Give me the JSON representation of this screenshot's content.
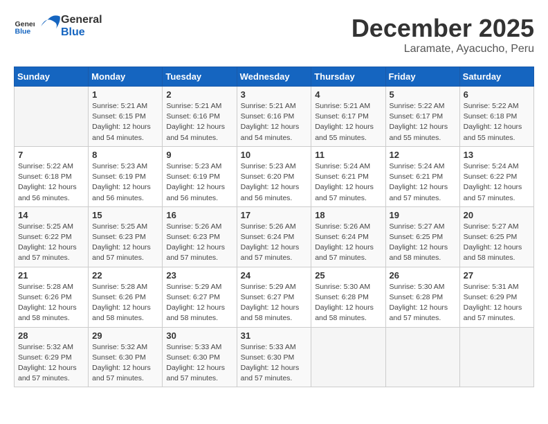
{
  "header": {
    "logo_general": "General",
    "logo_blue": "Blue",
    "month": "December 2025",
    "location": "Laramate, Ayacucho, Peru"
  },
  "calendar": {
    "days_of_week": [
      "Sunday",
      "Monday",
      "Tuesday",
      "Wednesday",
      "Thursday",
      "Friday",
      "Saturday"
    ],
    "weeks": [
      [
        {
          "day": "",
          "info": ""
        },
        {
          "day": "1",
          "info": "Sunrise: 5:21 AM\nSunset: 6:15 PM\nDaylight: 12 hours\nand 54 minutes."
        },
        {
          "day": "2",
          "info": "Sunrise: 5:21 AM\nSunset: 6:16 PM\nDaylight: 12 hours\nand 54 minutes."
        },
        {
          "day": "3",
          "info": "Sunrise: 5:21 AM\nSunset: 6:16 PM\nDaylight: 12 hours\nand 54 minutes."
        },
        {
          "day": "4",
          "info": "Sunrise: 5:21 AM\nSunset: 6:17 PM\nDaylight: 12 hours\nand 55 minutes."
        },
        {
          "day": "5",
          "info": "Sunrise: 5:22 AM\nSunset: 6:17 PM\nDaylight: 12 hours\nand 55 minutes."
        },
        {
          "day": "6",
          "info": "Sunrise: 5:22 AM\nSunset: 6:18 PM\nDaylight: 12 hours\nand 55 minutes."
        }
      ],
      [
        {
          "day": "7",
          "info": "Sunrise: 5:22 AM\nSunset: 6:18 PM\nDaylight: 12 hours\nand 56 minutes."
        },
        {
          "day": "8",
          "info": "Sunrise: 5:23 AM\nSunset: 6:19 PM\nDaylight: 12 hours\nand 56 minutes."
        },
        {
          "day": "9",
          "info": "Sunrise: 5:23 AM\nSunset: 6:19 PM\nDaylight: 12 hours\nand 56 minutes."
        },
        {
          "day": "10",
          "info": "Sunrise: 5:23 AM\nSunset: 6:20 PM\nDaylight: 12 hours\nand 56 minutes."
        },
        {
          "day": "11",
          "info": "Sunrise: 5:24 AM\nSunset: 6:21 PM\nDaylight: 12 hours\nand 57 minutes."
        },
        {
          "day": "12",
          "info": "Sunrise: 5:24 AM\nSunset: 6:21 PM\nDaylight: 12 hours\nand 57 minutes."
        },
        {
          "day": "13",
          "info": "Sunrise: 5:24 AM\nSunset: 6:22 PM\nDaylight: 12 hours\nand 57 minutes."
        }
      ],
      [
        {
          "day": "14",
          "info": "Sunrise: 5:25 AM\nSunset: 6:22 PM\nDaylight: 12 hours\nand 57 minutes."
        },
        {
          "day": "15",
          "info": "Sunrise: 5:25 AM\nSunset: 6:23 PM\nDaylight: 12 hours\nand 57 minutes."
        },
        {
          "day": "16",
          "info": "Sunrise: 5:26 AM\nSunset: 6:23 PM\nDaylight: 12 hours\nand 57 minutes."
        },
        {
          "day": "17",
          "info": "Sunrise: 5:26 AM\nSunset: 6:24 PM\nDaylight: 12 hours\nand 57 minutes."
        },
        {
          "day": "18",
          "info": "Sunrise: 5:26 AM\nSunset: 6:24 PM\nDaylight: 12 hours\nand 57 minutes."
        },
        {
          "day": "19",
          "info": "Sunrise: 5:27 AM\nSunset: 6:25 PM\nDaylight: 12 hours\nand 58 minutes."
        },
        {
          "day": "20",
          "info": "Sunrise: 5:27 AM\nSunset: 6:25 PM\nDaylight: 12 hours\nand 58 minutes."
        }
      ],
      [
        {
          "day": "21",
          "info": "Sunrise: 5:28 AM\nSunset: 6:26 PM\nDaylight: 12 hours\nand 58 minutes."
        },
        {
          "day": "22",
          "info": "Sunrise: 5:28 AM\nSunset: 6:26 PM\nDaylight: 12 hours\nand 58 minutes."
        },
        {
          "day": "23",
          "info": "Sunrise: 5:29 AM\nSunset: 6:27 PM\nDaylight: 12 hours\nand 58 minutes."
        },
        {
          "day": "24",
          "info": "Sunrise: 5:29 AM\nSunset: 6:27 PM\nDaylight: 12 hours\nand 58 minutes."
        },
        {
          "day": "25",
          "info": "Sunrise: 5:30 AM\nSunset: 6:28 PM\nDaylight: 12 hours\nand 58 minutes."
        },
        {
          "day": "26",
          "info": "Sunrise: 5:30 AM\nSunset: 6:28 PM\nDaylight: 12 hours\nand 57 minutes."
        },
        {
          "day": "27",
          "info": "Sunrise: 5:31 AM\nSunset: 6:29 PM\nDaylight: 12 hours\nand 57 minutes."
        }
      ],
      [
        {
          "day": "28",
          "info": "Sunrise: 5:32 AM\nSunset: 6:29 PM\nDaylight: 12 hours\nand 57 minutes."
        },
        {
          "day": "29",
          "info": "Sunrise: 5:32 AM\nSunset: 6:30 PM\nDaylight: 12 hours\nand 57 minutes."
        },
        {
          "day": "30",
          "info": "Sunrise: 5:33 AM\nSunset: 6:30 PM\nDaylight: 12 hours\nand 57 minutes."
        },
        {
          "day": "31",
          "info": "Sunrise: 5:33 AM\nSunset: 6:30 PM\nDaylight: 12 hours\nand 57 minutes."
        },
        {
          "day": "",
          "info": ""
        },
        {
          "day": "",
          "info": ""
        },
        {
          "day": "",
          "info": ""
        }
      ]
    ]
  }
}
